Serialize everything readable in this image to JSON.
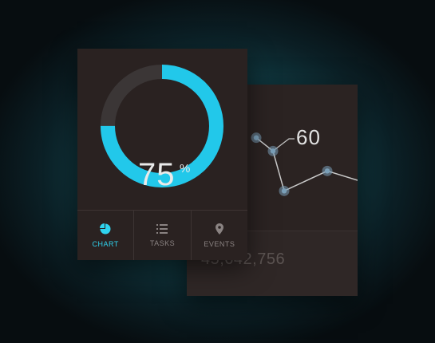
{
  "dashboard": {
    "progress": {
      "value_text": "75",
      "unit": "%",
      "fraction": 0.75,
      "ring_color": "#22c8ea",
      "track_color": "#3b3636"
    },
    "nav": {
      "items": [
        {
          "label": "CHART",
          "icon": "pie-chart-icon",
          "active": true
        },
        {
          "label": "TASKS",
          "icon": "list-icon",
          "active": false
        },
        {
          "label": "EVENTS",
          "icon": "location-pin-icon",
          "active": false
        }
      ]
    },
    "line_card": {
      "highlight_value": "60",
      "total": "45,642,756",
      "line_color": "#c9c9c9",
      "point_color": "#7a9fb8"
    }
  },
  "chart_data": {
    "type": "line",
    "series": [
      {
        "values": [
          70,
          60,
          30,
          45,
          38
        ]
      }
    ],
    "annotations": [
      "60"
    ]
  }
}
